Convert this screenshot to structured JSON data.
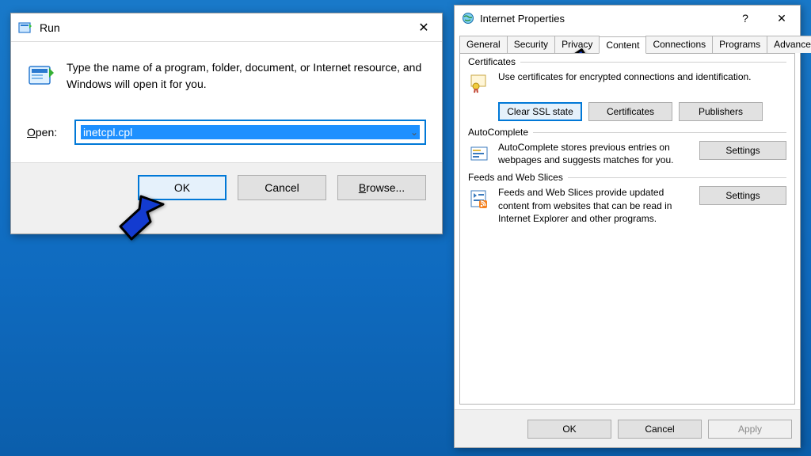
{
  "run": {
    "title": "Run",
    "description": "Type the name of a program, folder, document, or Internet resource, and Windows will open it for you.",
    "open_label_prefix": "O",
    "open_label_rest": "pen:",
    "input_value": "inetcpl.cpl",
    "buttons": {
      "ok": "OK",
      "cancel": "Cancel",
      "browse_prefix": "B",
      "browse_rest": "rowse..."
    }
  },
  "inet": {
    "title": "Internet Properties",
    "help_symbol": "?",
    "close_symbol": "✕",
    "tabs": [
      "General",
      "Security",
      "Privacy",
      "Content",
      "Connections",
      "Programs",
      "Advanced"
    ],
    "active_tab": 3,
    "certificates": {
      "legend": "Certificates",
      "text": "Use certificates for encrypted connections and identification.",
      "buttons": {
        "clear_ssl": "Clear SSL state",
        "certificates": "Certificates",
        "publishers": "Publishers"
      }
    },
    "autocomplete": {
      "legend": "AutoComplete",
      "text": "AutoComplete stores previous entries on webpages and suggests matches for you.",
      "button": "Settings"
    },
    "feeds": {
      "legend": "Feeds and Web Slices",
      "text": "Feeds and Web Slices provide updated content from websites that can be read in Internet Explorer and other programs.",
      "button": "Settings"
    },
    "footer": {
      "ok": "OK",
      "cancel": "Cancel",
      "apply": "Apply"
    }
  },
  "arrows": {
    "color": "#133bd0",
    "stroke": "#000000"
  }
}
